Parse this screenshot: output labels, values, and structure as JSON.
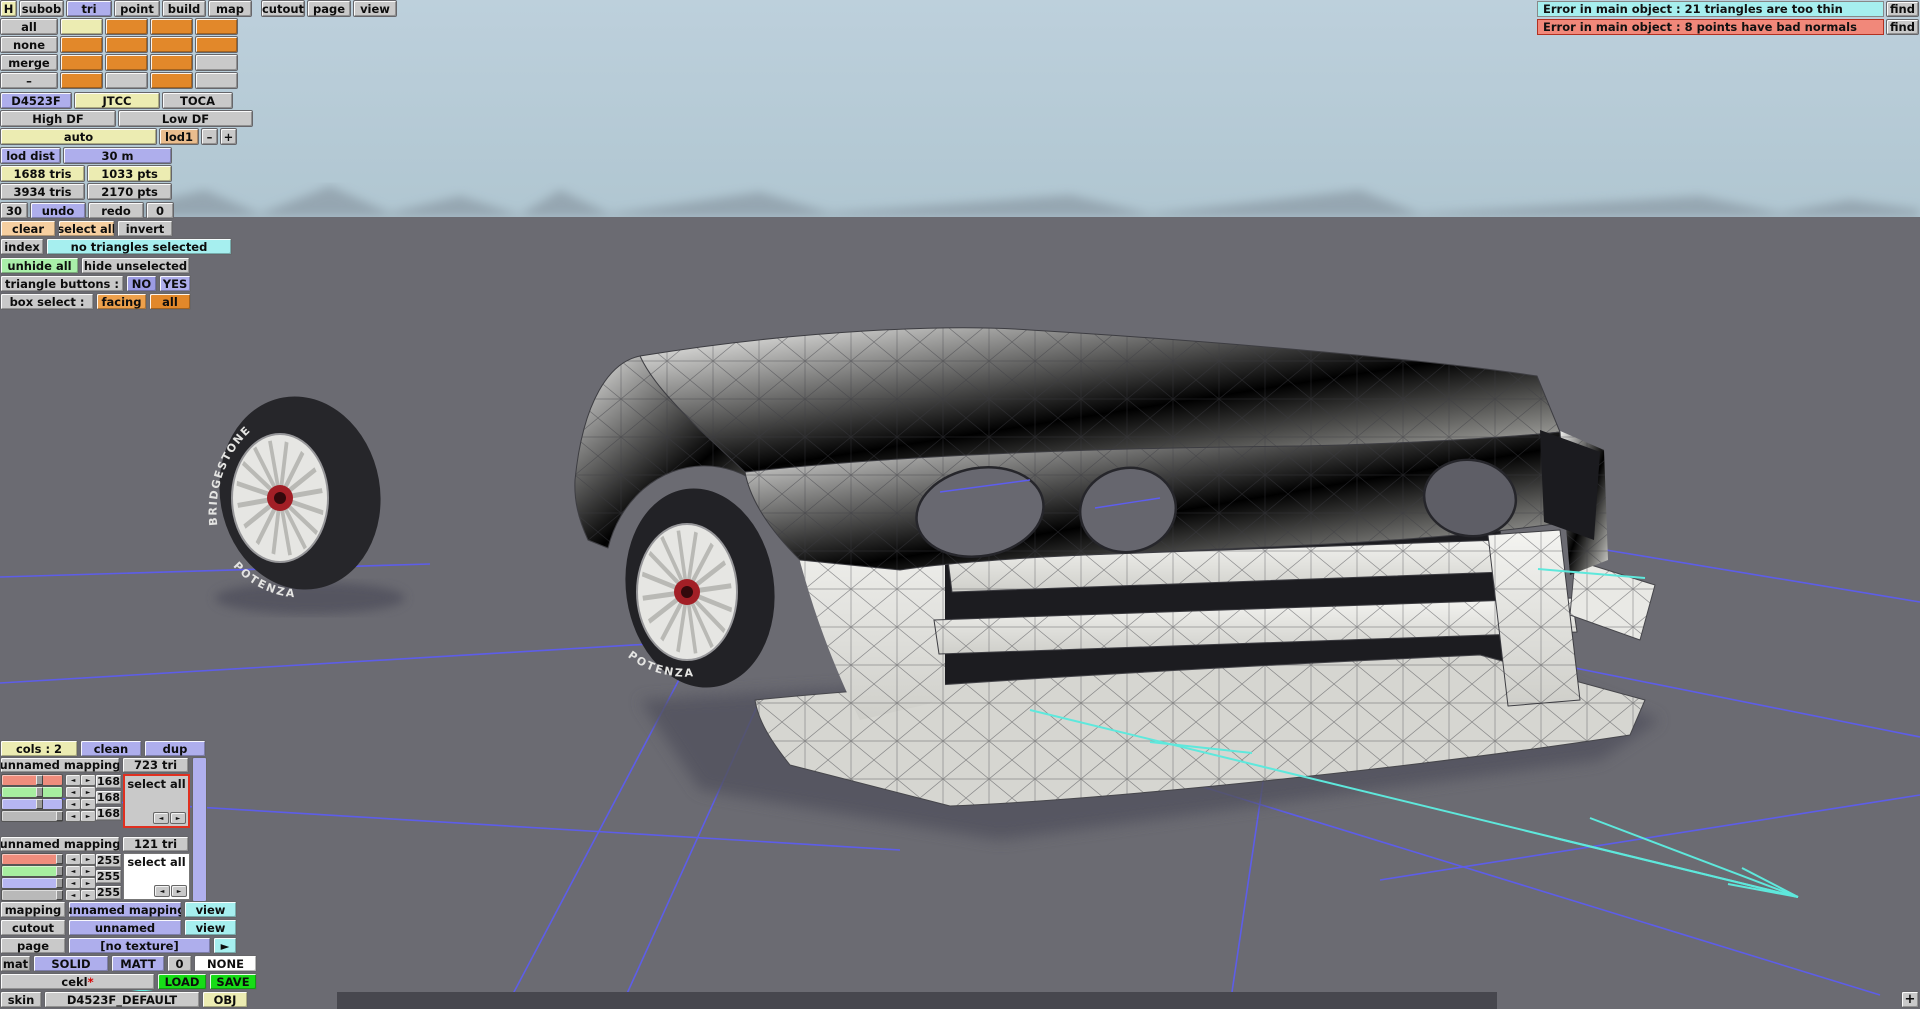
{
  "menu": {
    "items": [
      "H",
      "subob",
      "tri",
      "point",
      "build",
      "map",
      "cutout",
      "page",
      "view"
    ],
    "selected": "tri"
  },
  "subobject": {
    "row_labels": [
      "all",
      "none",
      "merge",
      "–"
    ],
    "grid": [
      [
        "yellow",
        "orange",
        "orange",
        "orange"
      ],
      [
        "orange",
        "orange",
        "orange",
        "orange"
      ],
      [
        "orange",
        "orange",
        "orange",
        "gray"
      ],
      [
        "orange",
        "gray",
        "orange",
        "gray"
      ]
    ],
    "variants": {
      "car": "D4523F",
      "series1": "JTCC",
      "series2": "TOCA"
    },
    "df": {
      "high": "High DF",
      "low": "Low DF"
    },
    "lod": {
      "auto": "auto",
      "current": "lod1",
      "minus": "–",
      "plus": "+",
      "dist_label": "lod dist",
      "dist_value": "30 m"
    },
    "stats": {
      "lod_tris": "1688 tris",
      "lod_pts": "1033 pts",
      "total_tris": "3934 tris",
      "total_pts": "2170 pts"
    },
    "history": {
      "undo_count": "30",
      "undo": "undo",
      "redo": "redo",
      "redo_count": "0"
    },
    "selection": {
      "clear": "clear",
      "select_all": "select all",
      "invert": "invert",
      "index": "index",
      "status": "no triangles selected",
      "unhide_all": "unhide all",
      "hide_unselected": "hide unselected"
    },
    "triangle_buttons": {
      "label": "triangle buttons :",
      "no": "NO",
      "yes": "YES"
    },
    "box_select": {
      "label": "box select :",
      "facing": "facing",
      "all": "all"
    }
  },
  "errors": [
    {
      "text": "Error in main object : 21 triangles are too thin",
      "action": "find",
      "color": "#a6efef"
    },
    {
      "text": "Error in main object : 8 points have bad normals",
      "action": "find",
      "color": "#f1887a"
    }
  ],
  "mapping_panel": {
    "header": {
      "cols": "cols : 2",
      "clean": "clean",
      "dup": "dup"
    },
    "blocks": [
      {
        "name": "unnamed mapping",
        "tri_count": "723 tri",
        "values": [
          "168",
          "168",
          "168"
        ],
        "select_all": "select all"
      },
      {
        "name": "unnamed mapping",
        "tri_count": "121 tri",
        "values": [
          "255",
          "255",
          "255"
        ],
        "select_all": "select all"
      }
    ],
    "rows": {
      "mapping_label": "mapping",
      "mapping_value": "unnamed mapping",
      "mapping_view": "view",
      "cutout_label": "cutout",
      "cutout_value": "unnamed",
      "cutout_view": "view",
      "page_label": "page",
      "page_value": "[no texture]",
      "mat_label": "mat",
      "mat_solid": "SOLID",
      "mat_matt": "MATT",
      "mat_zero": "0",
      "mat_none": "NONE",
      "texture_name": "cekl",
      "texture_modified": "*",
      "load": "LOAD",
      "save": "SAVE",
      "skin_label": "skin",
      "skin_value": "D4523F_DEFAULT",
      "skin_obj": "OBJ"
    }
  },
  "viewport": {
    "tire_brand": "BRIDGESTONE",
    "tire_model": "POTENZA",
    "colors": {
      "sky": "#b7cbd7",
      "ground": "#6b6b72",
      "grid": "#5d5df0",
      "axis": "#5ee8dc",
      "body": "#f1f1ee",
      "hub": "#a21f26"
    }
  },
  "ui_icons": {
    "arrow_left": "◄",
    "arrow_right": "►",
    "next": "►",
    "plus": "+",
    "minus": "–"
  }
}
